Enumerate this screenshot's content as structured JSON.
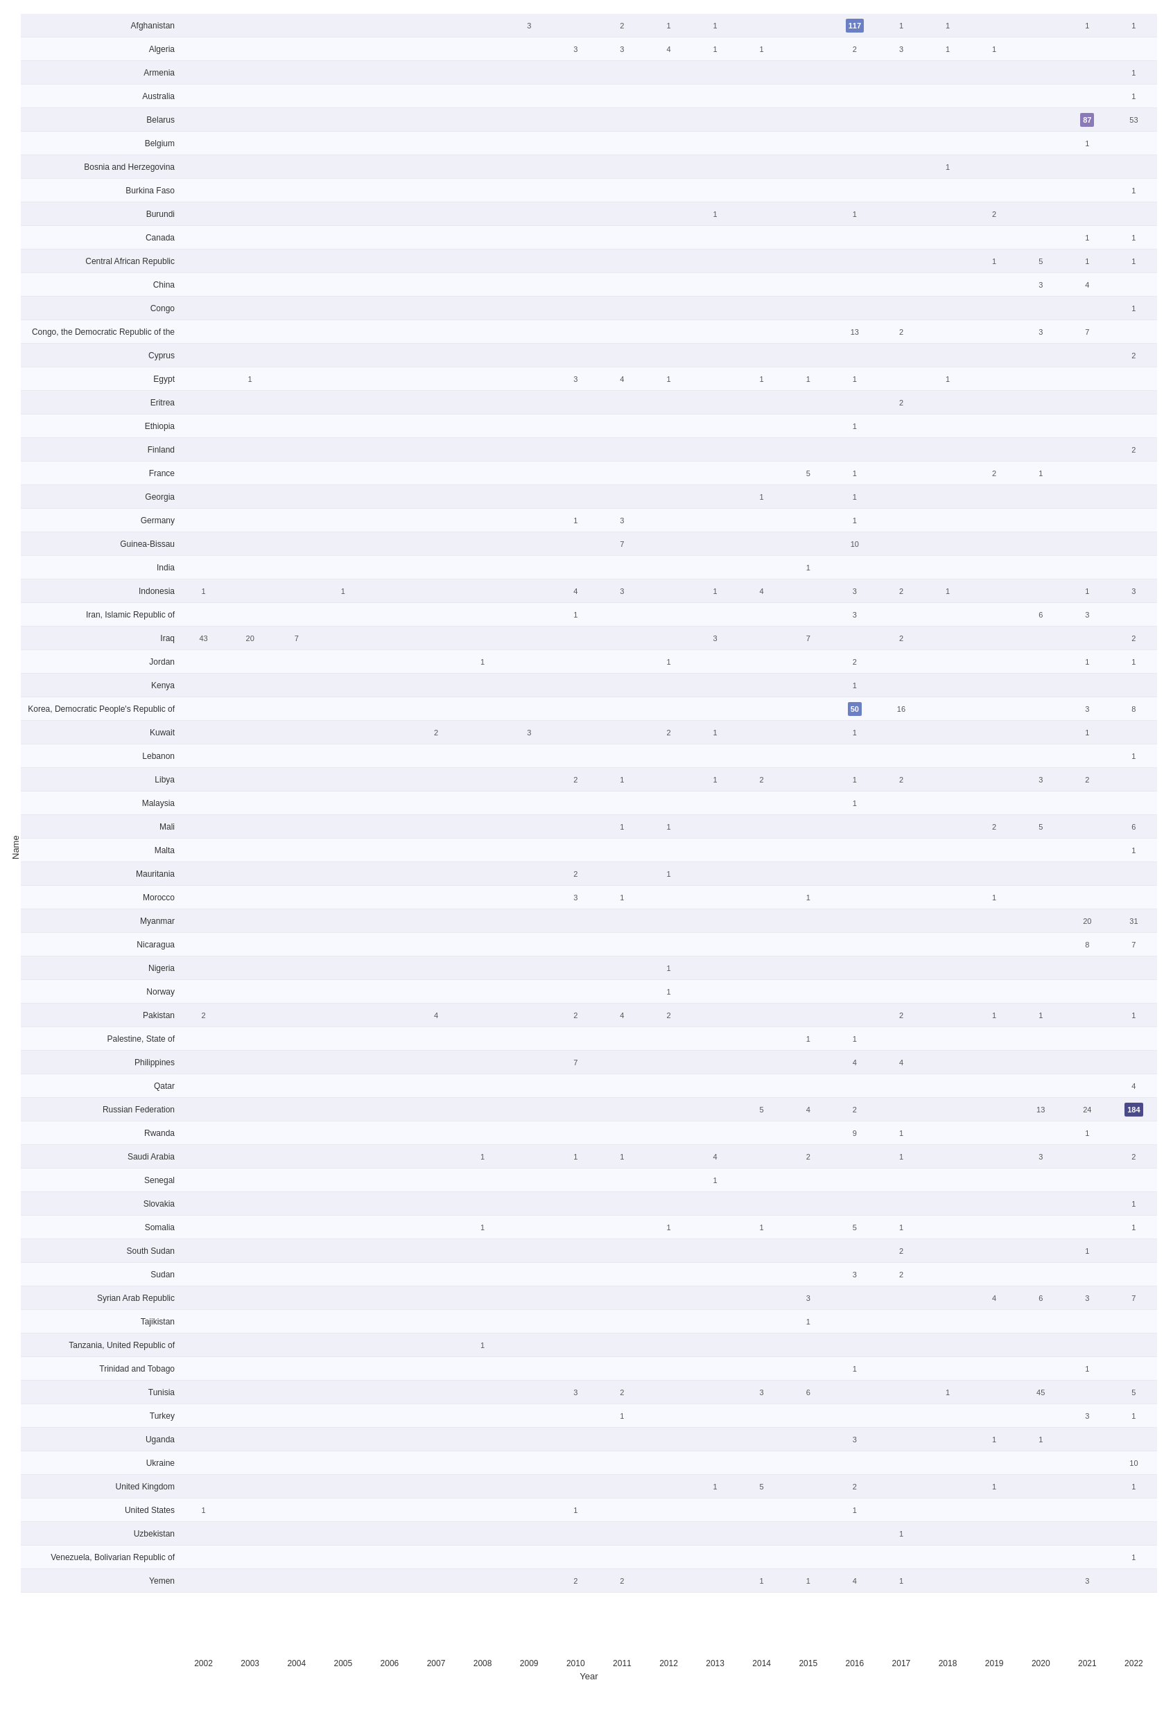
{
  "chart": {
    "title": "Name",
    "x_axis_label": "Year",
    "years": [
      "2002",
      "2003",
      "2004",
      "2005",
      "2006",
      "2007",
      "2008",
      "2009",
      "2010",
      "2011",
      "2012",
      "2013",
      "2014",
      "2015",
      "2016",
      "2017",
      "2018",
      "2019",
      "2020",
      "2021",
      "2022"
    ],
    "rows": [
      {
        "name": "Afghanistan",
        "values": {
          "2009": "3",
          "2011": "2",
          "2012": "1",
          "2013": "1",
          "2016": "117",
          "2017": "1",
          "2018": "1",
          "2021": "1",
          "2022": "1"
        },
        "highlights": {
          "2016": "blue"
        }
      },
      {
        "name": "Algeria",
        "values": {
          "2010": "3",
          "2011": "3",
          "2012": "4",
          "2013": "1",
          "2014": "1",
          "2016": "2",
          "2017": "3",
          "2018": "1",
          "2019": "1"
        },
        "highlights": {}
      },
      {
        "name": "Armenia",
        "values": {
          "2022": "1"
        },
        "highlights": {}
      },
      {
        "name": "Australia",
        "values": {
          "2022": "1"
        },
        "highlights": {}
      },
      {
        "name": "Belarus",
        "values": {
          "2021": "87",
          "2022": "53"
        },
        "highlights": {
          "2021": "purple",
          "2022": "normal-light"
        }
      },
      {
        "name": "Belgium",
        "values": {
          "2021": "1"
        },
        "highlights": {}
      },
      {
        "name": "Bosnia and Herzegovina",
        "values": {
          "2018": "1"
        },
        "highlights": {}
      },
      {
        "name": "Burkina Faso",
        "values": {
          "2022": "1"
        },
        "highlights": {}
      },
      {
        "name": "Burundi",
        "values": {
          "2013": "1",
          "2016": "1",
          "2019": "2"
        },
        "highlights": {}
      },
      {
        "name": "Canada",
        "values": {
          "2021": "1",
          "2022": "1"
        },
        "highlights": {}
      },
      {
        "name": "Central African Republic",
        "values": {
          "2019": "1",
          "2020": "5",
          "2021": "1",
          "2022": "1"
        },
        "highlights": {}
      },
      {
        "name": "China",
        "values": {
          "2020": "3",
          "2021": "4"
        },
        "highlights": {}
      },
      {
        "name": "Congo",
        "values": {
          "2022": "1"
        },
        "highlights": {}
      },
      {
        "name": "Congo, the Democratic Republic of the",
        "values": {
          "2016": "13",
          "2017": "2",
          "2020": "3",
          "2021": "7"
        },
        "highlights": {}
      },
      {
        "name": "Cyprus",
        "values": {
          "2022": "2"
        },
        "highlights": {}
      },
      {
        "name": "Egypt",
        "values": {
          "2003": "1",
          "2010": "3",
          "2011": "4",
          "2012": "1",
          "2014": "1",
          "2015": "1",
          "2016": "1",
          "2018": "1"
        },
        "highlights": {}
      },
      {
        "name": "Eritrea",
        "values": {
          "2017": "2"
        },
        "highlights": {}
      },
      {
        "name": "Ethiopia",
        "values": {
          "2016": "1"
        },
        "highlights": {}
      },
      {
        "name": "Finland",
        "values": {
          "2022": "2"
        },
        "highlights": {}
      },
      {
        "name": "France",
        "values": {
          "2015": "5",
          "2016": "1",
          "2019": "2",
          "2020": "1"
        },
        "highlights": {}
      },
      {
        "name": "Georgia",
        "values": {
          "2014": "1",
          "2016": "1"
        },
        "highlights": {}
      },
      {
        "name": "Germany",
        "values": {
          "2010": "1",
          "2011": "3",
          "2016": "1"
        },
        "highlights": {}
      },
      {
        "name": "Guinea-Bissau",
        "values": {
          "2011": "7",
          "2016": "10"
        },
        "highlights": {}
      },
      {
        "name": "India",
        "values": {
          "2015": "1"
        },
        "highlights": {}
      },
      {
        "name": "Indonesia",
        "values": {
          "2002": "1",
          "2005": "1",
          "2010": "4",
          "2011": "3",
          "2013": "1",
          "2014": "4",
          "2016": "3",
          "2017": "2",
          "2018": "1",
          "2021": "1",
          "2022": "3"
        },
        "highlights": {}
      },
      {
        "name": "Iran, Islamic Republic of",
        "values": {
          "2010": "1",
          "2016": "3",
          "2020": "6",
          "2021": "3"
        },
        "highlights": {}
      },
      {
        "name": "Iraq",
        "values": {
          "2002": "43",
          "2003": "20",
          "2004": "7",
          "2013": "3",
          "2015": "7",
          "2017": "2",
          "2022": "2"
        },
        "highlights": {}
      },
      {
        "name": "Jordan",
        "values": {
          "2008": "1",
          "2012": "1",
          "2016": "2",
          "2021": "1",
          "2022": "1"
        },
        "highlights": {}
      },
      {
        "name": "Kenya",
        "values": {
          "2016": "1"
        },
        "highlights": {}
      },
      {
        "name": "Korea, Democratic People's Republic of",
        "values": {
          "2016": "50",
          "2017": "16",
          "2021": "3",
          "2022": "8"
        },
        "highlights": {
          "2016": "blue"
        }
      },
      {
        "name": "Kuwait",
        "values": {
          "2007": "2",
          "2009": "3",
          "2012": "2",
          "2013": "1",
          "2016": "1",
          "2021": "1"
        },
        "highlights": {}
      },
      {
        "name": "Lebanon",
        "values": {
          "2022": "1"
        },
        "highlights": {}
      },
      {
        "name": "Libya",
        "values": {
          "2010": "2",
          "2011": "1",
          "2013": "1",
          "2014": "2",
          "2016": "1",
          "2017": "2",
          "2020": "3",
          "2021": "2"
        },
        "highlights": {}
      },
      {
        "name": "Malaysia",
        "values": {
          "2016": "1"
        },
        "highlights": {}
      },
      {
        "name": "Mali",
        "values": {
          "2011": "1",
          "2012": "1",
          "2019": "2",
          "2020": "5",
          "2022": "6"
        },
        "highlights": {}
      },
      {
        "name": "Malta",
        "values": {
          "2022": "1"
        },
        "highlights": {}
      },
      {
        "name": "Mauritania",
        "values": {
          "2010": "2",
          "2012": "1"
        },
        "highlights": {}
      },
      {
        "name": "Morocco",
        "values": {
          "2010": "3",
          "2011": "1",
          "2015": "1",
          "2019": "1"
        },
        "highlights": {}
      },
      {
        "name": "Myanmar",
        "values": {
          "2021": "20",
          "2022": "31"
        },
        "highlights": {}
      },
      {
        "name": "Nicaragua",
        "values": {
          "2021": "8",
          "2022": "7"
        },
        "highlights": {}
      },
      {
        "name": "Nigeria",
        "values": {
          "2012": "1"
        },
        "highlights": {}
      },
      {
        "name": "Norway",
        "values": {
          "2012": "1"
        },
        "highlights": {}
      },
      {
        "name": "Pakistan",
        "values": {
          "2002": "2",
          "2007": "4",
          "2010": "2",
          "2011": "4",
          "2012": "2",
          "2017": "2",
          "2019": "1",
          "2020": "1",
          "2022": "1"
        },
        "highlights": {}
      },
      {
        "name": "Palestine, State of",
        "values": {
          "2015": "1",
          "2016": "1"
        },
        "highlights": {}
      },
      {
        "name": "Philippines",
        "values": {
          "2010": "7",
          "2016": "4",
          "2017": "4"
        },
        "highlights": {}
      },
      {
        "name": "Qatar",
        "values": {
          "2022": "4"
        },
        "highlights": {}
      },
      {
        "name": "Russian Federation",
        "values": {
          "2014": "5",
          "2015": "4",
          "2016": "2",
          "2020": "13",
          "2021": "24",
          "2022": "184"
        },
        "highlights": {
          "2022": "dark"
        }
      },
      {
        "name": "Rwanda",
        "values": {
          "2016": "9",
          "2017": "1",
          "2021": "1"
        },
        "highlights": {}
      },
      {
        "name": "Saudi Arabia",
        "values": {
          "2008": "1",
          "2010": "1",
          "2011": "1",
          "2013": "4",
          "2015": "2",
          "2017": "1",
          "2020": "3",
          "2022": "2"
        },
        "highlights": {}
      },
      {
        "name": "Senegal",
        "values": {
          "2013": "1"
        },
        "highlights": {}
      },
      {
        "name": "Slovakia",
        "values": {
          "2022": "1"
        },
        "highlights": {}
      },
      {
        "name": "Somalia",
        "values": {
          "2008": "1",
          "2012": "1",
          "2014": "1",
          "2016": "5",
          "2017": "1",
          "2022": "1"
        },
        "highlights": {}
      },
      {
        "name": "South Sudan",
        "values": {
          "2017": "2",
          "2021": "1"
        },
        "highlights": {}
      },
      {
        "name": "Sudan",
        "values": {
          "2016": "3",
          "2017": "2"
        },
        "highlights": {}
      },
      {
        "name": "Syrian Arab Republic",
        "values": {
          "2015": "3",
          "2019": "4",
          "2020": "6",
          "2021": "3",
          "2022": "7"
        },
        "highlights": {}
      },
      {
        "name": "Tajikistan",
        "values": {
          "2015": "1"
        },
        "highlights": {}
      },
      {
        "name": "Tanzania, United Republic of",
        "values": {
          "2008": "1"
        },
        "highlights": {}
      },
      {
        "name": "Trinidad and Tobago",
        "values": {
          "2016": "1",
          "2021": "1"
        },
        "highlights": {}
      },
      {
        "name": "Tunisia",
        "values": {
          "2010": "3",
          "2011": "2",
          "2014": "3",
          "2015": "6",
          "2018": "1",
          "2020": "45",
          "2022": "5"
        },
        "highlights": {}
      },
      {
        "name": "Turkey",
        "values": {
          "2011": "1",
          "2021": "3",
          "2022": "1"
        },
        "highlights": {}
      },
      {
        "name": "Uganda",
        "values": {
          "2016": "3",
          "2019": "1",
          "2020": "1"
        },
        "highlights": {}
      },
      {
        "name": "Ukraine",
        "values": {
          "2022": "10"
        },
        "highlights": {}
      },
      {
        "name": "United Kingdom",
        "values": {
          "2013": "1",
          "2014": "5",
          "2016": "2",
          "2019": "1",
          "2022": "1"
        },
        "highlights": {}
      },
      {
        "name": "United States",
        "values": {
          "2002": "1",
          "2010": "1",
          "2016": "1"
        },
        "highlights": {}
      },
      {
        "name": "Uzbekistan",
        "values": {
          "2017": "1"
        },
        "highlights": {}
      },
      {
        "name": "Venezuela, Bolivarian Republic of",
        "values": {
          "2022": "1"
        },
        "highlights": {}
      },
      {
        "name": "Yemen",
        "values": {
          "2010": "2",
          "2011": "2",
          "2014": "1",
          "2015": "1",
          "2016": "4",
          "2017": "1",
          "2021": "3"
        },
        "highlights": {}
      }
    ]
  }
}
